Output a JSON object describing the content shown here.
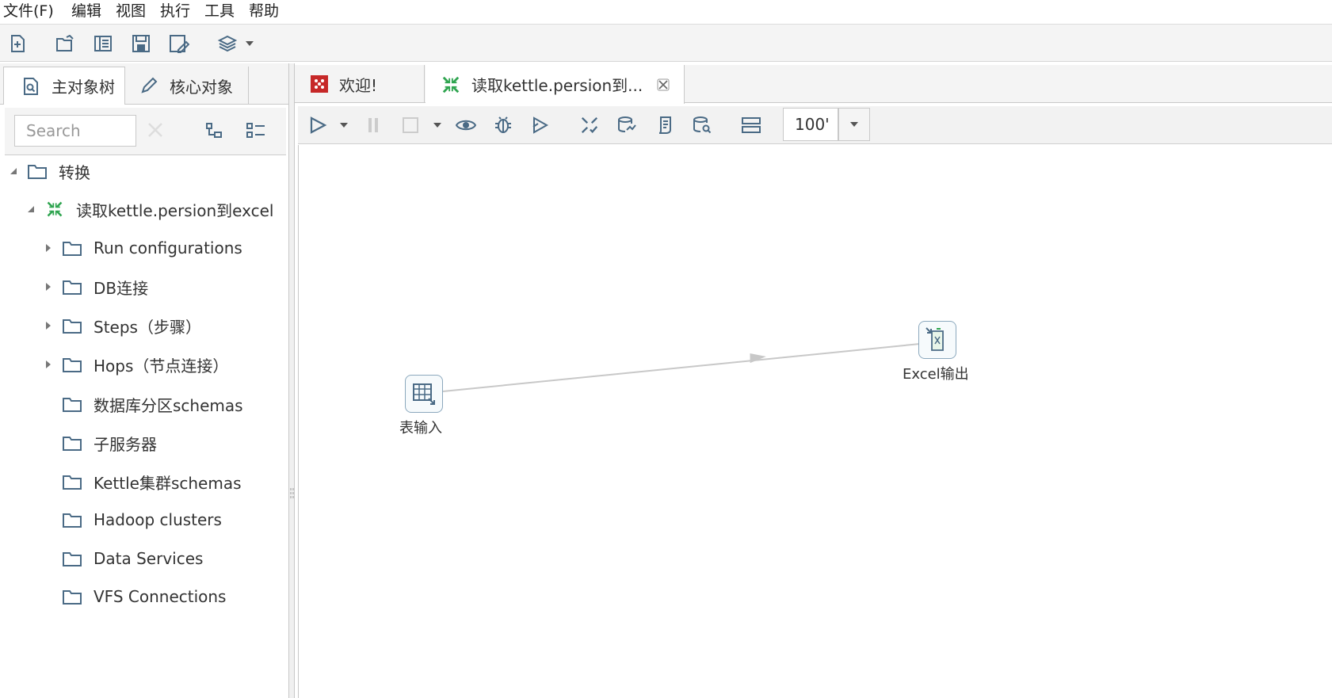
{
  "menu": {
    "file": "文件(F)",
    "edit": "编辑",
    "view": "视图",
    "run": "执行",
    "tools": "工具",
    "help": "帮助"
  },
  "left_tabs": {
    "main_tree": "主对象树",
    "core_objects": "核心对象"
  },
  "search": {
    "placeholder": "Search"
  },
  "tree": {
    "root": "转换",
    "transform": "读取kettle.persion到excel",
    "items": [
      "Run configurations",
      "DB连接",
      "Steps（步骤）",
      "Hops（节点连接）",
      "数据库分区schemas",
      "子服务器",
      "Kettle集群schemas",
      "Hadoop clusters",
      "Data Services",
      "VFS Connections"
    ]
  },
  "right_tabs": {
    "welcome": "欢迎!",
    "transform": "读取kettle.persion到..."
  },
  "zoom": {
    "value": "100'"
  },
  "steps": {
    "table_input": "表输入",
    "excel_output": "Excel输出"
  },
  "colors": {
    "accent_green": "#2ea44f",
    "welcome_red": "#c62828",
    "icon_blue": "#4a6a85",
    "hop_gray": "#c8c8c8"
  }
}
